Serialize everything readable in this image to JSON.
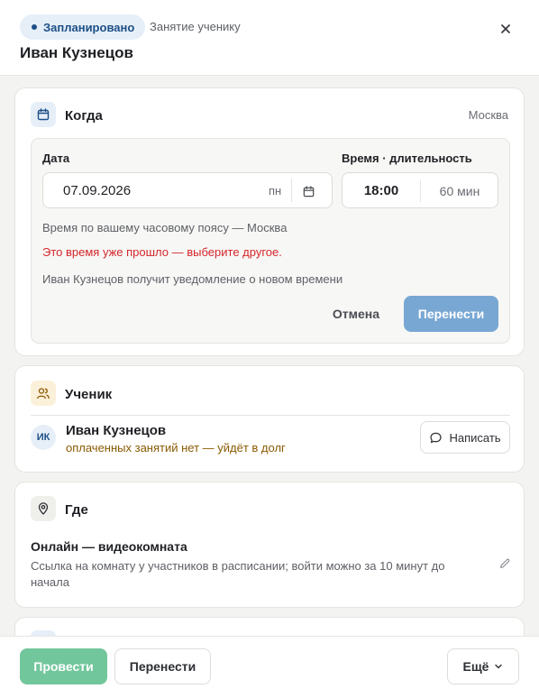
{
  "header": {
    "status": "Запланировано",
    "subtitle": "Занятие ученику",
    "title": "Иван Кузнецов",
    "close_icon": "close-icon"
  },
  "when": {
    "title": "Когда",
    "timezone": "Москва",
    "date_label": "Дата",
    "date_value": "07.09.2026",
    "date_weekday": "пн",
    "time_label": "Время · длительность",
    "time_value": "18:00",
    "duration_value": "60 мин",
    "tz_note": "Время по вашему часовому поясу — Москва",
    "error_note": "Это время уже прошло — выберите другое.",
    "notify_note": "Иван Кузнецов получит уведомление о новом времени",
    "cancel_label": "Отмена",
    "reschedule_label": "Перенести"
  },
  "student": {
    "title": "Ученик",
    "initials": "ИК",
    "name": "Иван Кузнецов",
    "balance_note": "оплаченных занятий нет — уйдёт в долг",
    "message_label": "Написать"
  },
  "where": {
    "title": "Где",
    "location_title": "Онлайн — видеокомната",
    "location_desc": "Ссылка на комнату у участников в расписании; войти можно за 10 минут до начала"
  },
  "footer": {
    "primary_label": "Провести",
    "secondary_label": "Перенести",
    "more_label": "Ещё"
  },
  "colors": {
    "accent_blue": "#1d4f86",
    "error_red": "#d5262b",
    "debt_amber": "#8a5a00",
    "primary_green": "#72c69c",
    "reschedule_blue": "#78a7d3"
  }
}
